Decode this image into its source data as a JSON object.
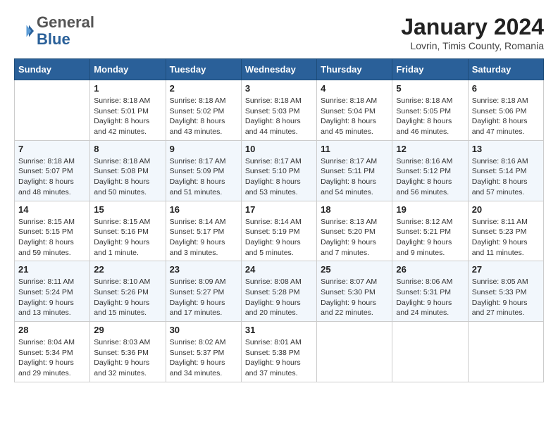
{
  "header": {
    "logo_general": "General",
    "logo_blue": "Blue",
    "month_title": "January 2024",
    "location": "Lovrin, Timis County, Romania"
  },
  "days_of_week": [
    "Sunday",
    "Monday",
    "Tuesday",
    "Wednesday",
    "Thursday",
    "Friday",
    "Saturday"
  ],
  "weeks": [
    [
      {
        "day": "",
        "sunrise": "",
        "sunset": "",
        "daylight": ""
      },
      {
        "day": "1",
        "sunrise": "8:18 AM",
        "sunset": "5:01 PM",
        "daylight": "8 hours and 42 minutes."
      },
      {
        "day": "2",
        "sunrise": "8:18 AM",
        "sunset": "5:02 PM",
        "daylight": "8 hours and 43 minutes."
      },
      {
        "day": "3",
        "sunrise": "8:18 AM",
        "sunset": "5:03 PM",
        "daylight": "8 hours and 44 minutes."
      },
      {
        "day": "4",
        "sunrise": "8:18 AM",
        "sunset": "5:04 PM",
        "daylight": "8 hours and 45 minutes."
      },
      {
        "day": "5",
        "sunrise": "8:18 AM",
        "sunset": "5:05 PM",
        "daylight": "8 hours and 46 minutes."
      },
      {
        "day": "6",
        "sunrise": "8:18 AM",
        "sunset": "5:06 PM",
        "daylight": "8 hours and 47 minutes."
      }
    ],
    [
      {
        "day": "7",
        "sunrise": "8:18 AM",
        "sunset": "5:07 PM",
        "daylight": "8 hours and 48 minutes."
      },
      {
        "day": "8",
        "sunrise": "8:18 AM",
        "sunset": "5:08 PM",
        "daylight": "8 hours and 50 minutes."
      },
      {
        "day": "9",
        "sunrise": "8:17 AM",
        "sunset": "5:09 PM",
        "daylight": "8 hours and 51 minutes."
      },
      {
        "day": "10",
        "sunrise": "8:17 AM",
        "sunset": "5:10 PM",
        "daylight": "8 hours and 53 minutes."
      },
      {
        "day": "11",
        "sunrise": "8:17 AM",
        "sunset": "5:11 PM",
        "daylight": "8 hours and 54 minutes."
      },
      {
        "day": "12",
        "sunrise": "8:16 AM",
        "sunset": "5:12 PM",
        "daylight": "8 hours and 56 minutes."
      },
      {
        "day": "13",
        "sunrise": "8:16 AM",
        "sunset": "5:14 PM",
        "daylight": "8 hours and 57 minutes."
      }
    ],
    [
      {
        "day": "14",
        "sunrise": "8:15 AM",
        "sunset": "5:15 PM",
        "daylight": "8 hours and 59 minutes."
      },
      {
        "day": "15",
        "sunrise": "8:15 AM",
        "sunset": "5:16 PM",
        "daylight": "9 hours and 1 minute."
      },
      {
        "day": "16",
        "sunrise": "8:14 AM",
        "sunset": "5:17 PM",
        "daylight": "9 hours and 3 minutes."
      },
      {
        "day": "17",
        "sunrise": "8:14 AM",
        "sunset": "5:19 PM",
        "daylight": "9 hours and 5 minutes."
      },
      {
        "day": "18",
        "sunrise": "8:13 AM",
        "sunset": "5:20 PM",
        "daylight": "9 hours and 7 minutes."
      },
      {
        "day": "19",
        "sunrise": "8:12 AM",
        "sunset": "5:21 PM",
        "daylight": "9 hours and 9 minutes."
      },
      {
        "day": "20",
        "sunrise": "8:11 AM",
        "sunset": "5:23 PM",
        "daylight": "9 hours and 11 minutes."
      }
    ],
    [
      {
        "day": "21",
        "sunrise": "8:11 AM",
        "sunset": "5:24 PM",
        "daylight": "9 hours and 13 minutes."
      },
      {
        "day": "22",
        "sunrise": "8:10 AM",
        "sunset": "5:26 PM",
        "daylight": "9 hours and 15 minutes."
      },
      {
        "day": "23",
        "sunrise": "8:09 AM",
        "sunset": "5:27 PM",
        "daylight": "9 hours and 17 minutes."
      },
      {
        "day": "24",
        "sunrise": "8:08 AM",
        "sunset": "5:28 PM",
        "daylight": "9 hours and 20 minutes."
      },
      {
        "day": "25",
        "sunrise": "8:07 AM",
        "sunset": "5:30 PM",
        "daylight": "9 hours and 22 minutes."
      },
      {
        "day": "26",
        "sunrise": "8:06 AM",
        "sunset": "5:31 PM",
        "daylight": "9 hours and 24 minutes."
      },
      {
        "day": "27",
        "sunrise": "8:05 AM",
        "sunset": "5:33 PM",
        "daylight": "9 hours and 27 minutes."
      }
    ],
    [
      {
        "day": "28",
        "sunrise": "8:04 AM",
        "sunset": "5:34 PM",
        "daylight": "9 hours and 29 minutes."
      },
      {
        "day": "29",
        "sunrise": "8:03 AM",
        "sunset": "5:36 PM",
        "daylight": "9 hours and 32 minutes."
      },
      {
        "day": "30",
        "sunrise": "8:02 AM",
        "sunset": "5:37 PM",
        "daylight": "9 hours and 34 minutes."
      },
      {
        "day": "31",
        "sunrise": "8:01 AM",
        "sunset": "5:38 PM",
        "daylight": "9 hours and 37 minutes."
      },
      {
        "day": "",
        "sunrise": "",
        "sunset": "",
        "daylight": ""
      },
      {
        "day": "",
        "sunrise": "",
        "sunset": "",
        "daylight": ""
      },
      {
        "day": "",
        "sunrise": "",
        "sunset": "",
        "daylight": ""
      }
    ]
  ]
}
